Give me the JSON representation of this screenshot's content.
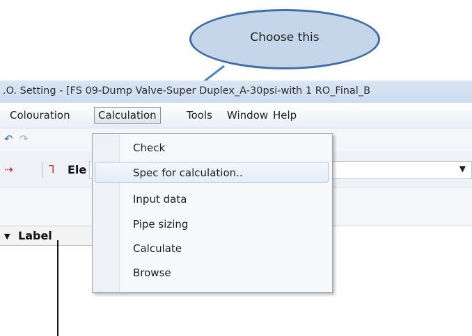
{
  "callout": {
    "text": "Choose this"
  },
  "window": {
    "title": ".O. Setting - [FS 09-Dump Valve-Super Duplex_A-30psi-with 1 RO_Final_B"
  },
  "menubar": {
    "items": [
      {
        "label": "Colouration"
      },
      {
        "label": "Calculation"
      },
      {
        "label": "Tools"
      },
      {
        "label": "Window"
      },
      {
        "label": "Help"
      }
    ]
  },
  "toolbar": {
    "undo_icon": "undo-icon",
    "redo_icon": "redo-icon",
    "element_selector_text": "Ele"
  },
  "calculation_menu": {
    "items": [
      {
        "label": "Check"
      },
      {
        "label": "Spec for calculation.."
      },
      {
        "label": "Input data"
      },
      {
        "label": "Pipe sizing"
      },
      {
        "label": "Calculate"
      },
      {
        "label": "Browse"
      }
    ],
    "highlighted_index": 1
  },
  "grid": {
    "column_header": "Label"
  },
  "colors": {
    "accent": "#3f6ea5",
    "callout_fill": "#c6d6ea",
    "title_bar": "#dbe6f4"
  }
}
